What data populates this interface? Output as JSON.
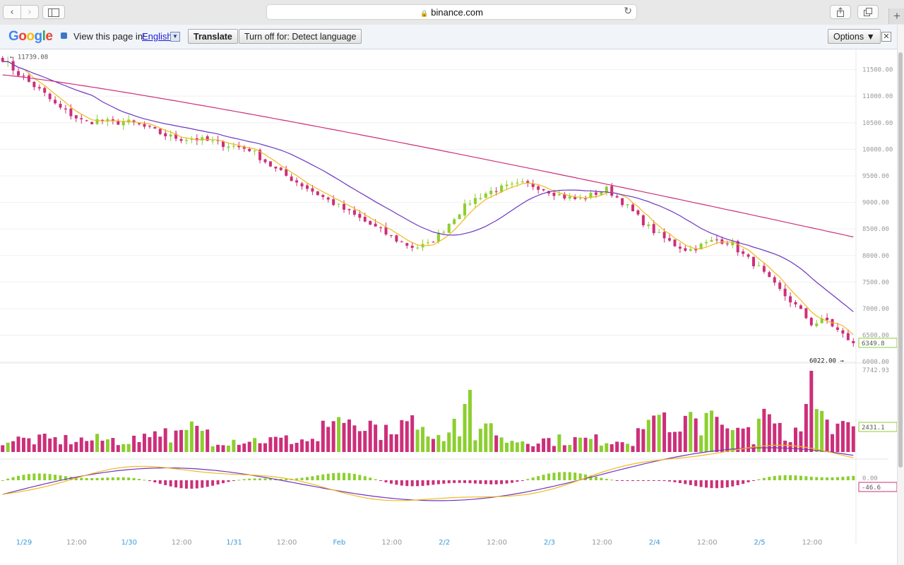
{
  "browser": {
    "url": "binance.com",
    "nav_back": "‹",
    "nav_forward": "›",
    "reload": "↻",
    "new_tab": "+"
  },
  "translate_bar": {
    "logo": "Google",
    "prompt": "View this page in:",
    "language": "English",
    "translate_label": "Translate",
    "turn_off_label": "Turn off for: Detect language",
    "options_label": "Options ▼",
    "close": "✕"
  },
  "chart_data": {
    "type": "candlestick",
    "title": "",
    "x_labels": [
      "1/29",
      "12:00",
      "1/30",
      "12:00",
      "1/31",
      "12:00",
      "Feb",
      "12:00",
      "2/2",
      "12:00",
      "2/3",
      "12:00",
      "2/4",
      "12:00",
      "2/5",
      "12:00"
    ],
    "price_axis": {
      "ticks": [
        "11500.00",
        "11000.00",
        "10500.00",
        "10000.00",
        "9500.00",
        "9000.00",
        "8500.00",
        "8000.00",
        "7500.00",
        "7000.00",
        "6500.00",
        "6000.00"
      ],
      "range": [
        5950,
        11800
      ]
    },
    "price_annotations": {
      "high": "11739.08",
      "low": "6022.00",
      "last": "6349.8"
    },
    "price_path": [
      11700,
      11450,
      11250,
      11050,
      10800,
      10650,
      10500,
      10550,
      10500,
      10520,
      10450,
      10350,
      10250,
      10200,
      10200,
      10150,
      10100,
      10050,
      10000,
      9800,
      9600,
      9450,
      9300,
      9150,
      9000,
      8850,
      8700,
      8550,
      8400,
      8250,
      8150,
      8200,
      8450,
      8750,
      9000,
      9150,
      9250,
      9300,
      9350,
      9300,
      9200,
      9100,
      9050,
      9150,
      9250,
      9050,
      8800,
      8550,
      8350,
      8200,
      8100,
      8200,
      8300,
      8250,
      8000,
      7800,
      7500,
      7250,
      7000,
      6700,
      6800,
      6550,
      6349
    ],
    "volume_axis": {
      "max_label": "7742.93",
      "last": "2431.1"
    },
    "macd_axis": {
      "zero_label": "0.00",
      "last": "-46.6"
    },
    "colors": {
      "bull": "#8ccf2f",
      "bear": "#cc2f7a",
      "ma_fast": "#f2b81d",
      "ma_mid": "#6c35c4",
      "ma_slow": "#cc2f7a",
      "axis_text": "#999999",
      "date_text": "#3b9ad9",
      "gridline": "#f0f0f0"
    }
  }
}
